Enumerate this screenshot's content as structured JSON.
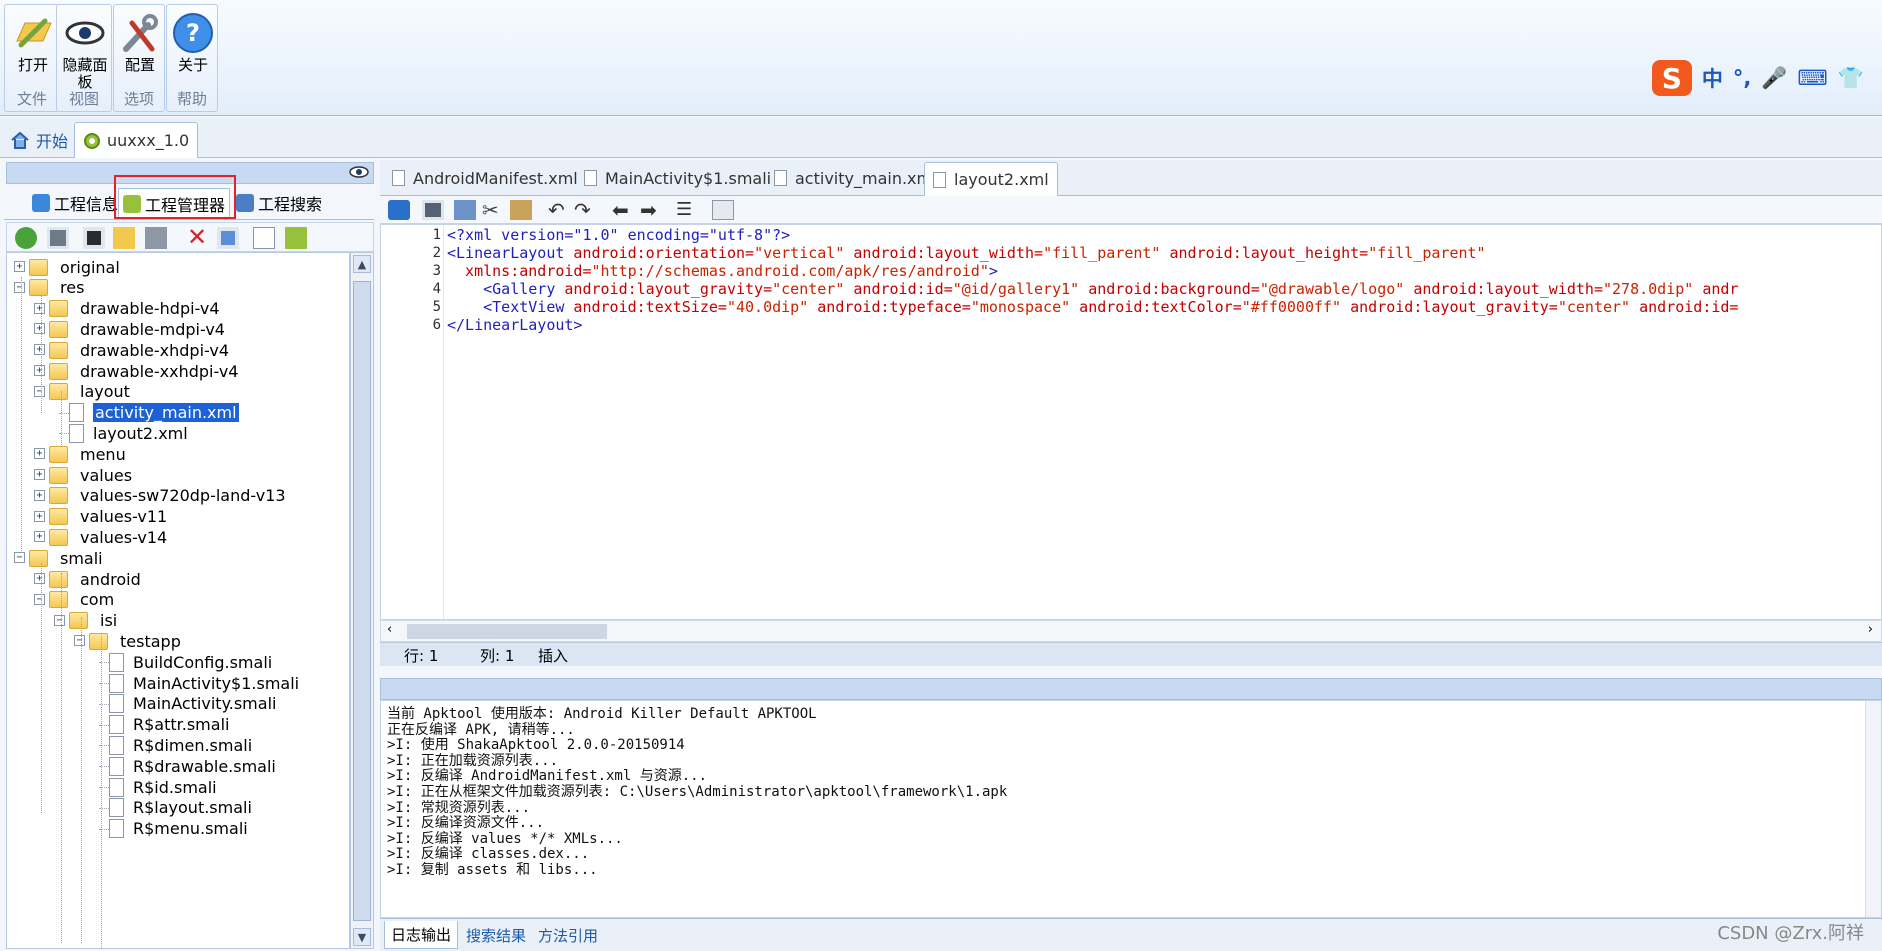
{
  "ribbon": {
    "groups": [
      {
        "label": "文件",
        "buttons": [
          {
            "label": "打开"
          }
        ]
      },
      {
        "label": "视图",
        "buttons": [
          {
            "label": "隐藏面板"
          }
        ]
      },
      {
        "label": "选项",
        "buttons": [
          {
            "label": "配置"
          }
        ]
      },
      {
        "label": "帮助",
        "buttons": [
          {
            "label": "关于"
          }
        ]
      }
    ],
    "ime": {
      "logo": "S",
      "lang": "中",
      "punct": "°,"
    }
  },
  "doc_tabs": [
    {
      "label": "开始",
      "icon": "home-icon"
    },
    {
      "label": "uuxxx_1.0",
      "icon": "android-gear-icon"
    }
  ],
  "left_panel": {
    "tabs": [
      {
        "label": "工程信息"
      },
      {
        "label": "工程管理器"
      },
      {
        "label": "工程搜索"
      }
    ],
    "tree": [
      {
        "label": "original"
      },
      {
        "label": "res"
      },
      {
        "label": "drawable-hdpi-v4"
      },
      {
        "label": "drawable-mdpi-v4"
      },
      {
        "label": "drawable-xhdpi-v4"
      },
      {
        "label": "drawable-xxhdpi-v4"
      },
      {
        "label": "layout"
      },
      {
        "label": "activity_main.xml"
      },
      {
        "label": "layout2.xml"
      },
      {
        "label": "menu"
      },
      {
        "label": "values"
      },
      {
        "label": "values-sw720dp-land-v13"
      },
      {
        "label": "values-v11"
      },
      {
        "label": "values-v14"
      },
      {
        "label": "smali"
      },
      {
        "label": "android"
      },
      {
        "label": "com"
      },
      {
        "label": "isi"
      },
      {
        "label": "testapp"
      },
      {
        "label": "BuildConfig.smali"
      },
      {
        "label": "MainActivity$1.smali"
      },
      {
        "label": "MainActivity.smali"
      },
      {
        "label": "R$attr.smali"
      },
      {
        "label": "R$dimen.smali"
      },
      {
        "label": "R$drawable.smali"
      },
      {
        "label": "R$id.smali"
      },
      {
        "label": "R$layout.smali"
      },
      {
        "label": "R$menu.smali"
      }
    ]
  },
  "editor": {
    "tabs": [
      {
        "label": "AndroidManifest.xml"
      },
      {
        "label": "MainActivity$1.smali"
      },
      {
        "label": "activity_main.xml"
      },
      {
        "label": "layout2.xml"
      }
    ],
    "line_numbers": [
      "1",
      "2",
      "3",
      "4",
      "5",
      "6"
    ],
    "code": {
      "l1": "<?xml version=\"1.0\" encoding=\"utf-8\"?>",
      "l2_tag": "<LinearLayout",
      "l2_a1": " android:orientation=",
      "l2_v1": "\"vertical\"",
      "l2_a2": " android:layout_width=",
      "l2_v2": "\"fill_parent\"",
      "l2_a3": " android:layout_height=",
      "l2_v3": "\"fill_parent\"",
      "l3_a": "  xmlns:android=",
      "l3_v": "\"http://schemas.android.com/apk/res/android\"",
      "l3_end": ">",
      "l4_tag": "    <Gallery",
      "l4_a1": " android:layout_gravity=",
      "l4_v1": "\"center\"",
      "l4_a2": " android:id=",
      "l4_v2": "\"@id/gallery1\"",
      "l4_a3": " android:background=",
      "l4_v3": "\"@drawable/logo\"",
      "l4_a4": " android:layout_width=",
      "l4_v4": "\"278.0dip\"",
      "l4_a5": " andr",
      "l5_tag": "    <TextView",
      "l5_a1": " android:textSize=",
      "l5_v1": "\"40.0dip\"",
      "l5_a2": " android:typeface=",
      "l5_v2": "\"monospace\"",
      "l5_a3": " android:textColor=",
      "l5_v3": "\"#ff0000ff\"",
      "l5_a4": " android:layout_gravity=",
      "l5_v4": "\"center\"",
      "l5_a5": " android:id=",
      "l6": "</LinearLayout>"
    },
    "status": {
      "row": "行: 1",
      "col": "列: 1",
      "mode": "插入"
    }
  },
  "output": {
    "lines": [
      "当前 Apktool 使用版本: Android Killer Default APKTOOL",
      "正在反编译 APK, 请稍等...",
      ">I: 使用 ShakaApktool 2.0.0-20150914",
      ">I: 正在加载资源列表...",
      ">I: 反编译 AndroidManifest.xml 与资源...",
      ">I: 正在从框架文件加载资源列表: C:\\Users\\Administrator\\apktool\\framework\\1.apk",
      ">I: 常规资源列表...",
      ">I: 反编译资源文件...",
      ">I: 反编译 values */* XMLs...",
      ">I: 反编译 classes.dex...",
      ">I: 复制 assets 和 libs..."
    ],
    "tabs": [
      {
        "label": "日志输出"
      },
      {
        "label": "搜索结果"
      },
      {
        "label": "方法引用"
      }
    ]
  },
  "watermark": "CSDN @Zrx.阿祥",
  "colors": {
    "accent": "#1c62d6",
    "highlight_box": "#e0222a",
    "panel_header": "#c8daf1"
  }
}
